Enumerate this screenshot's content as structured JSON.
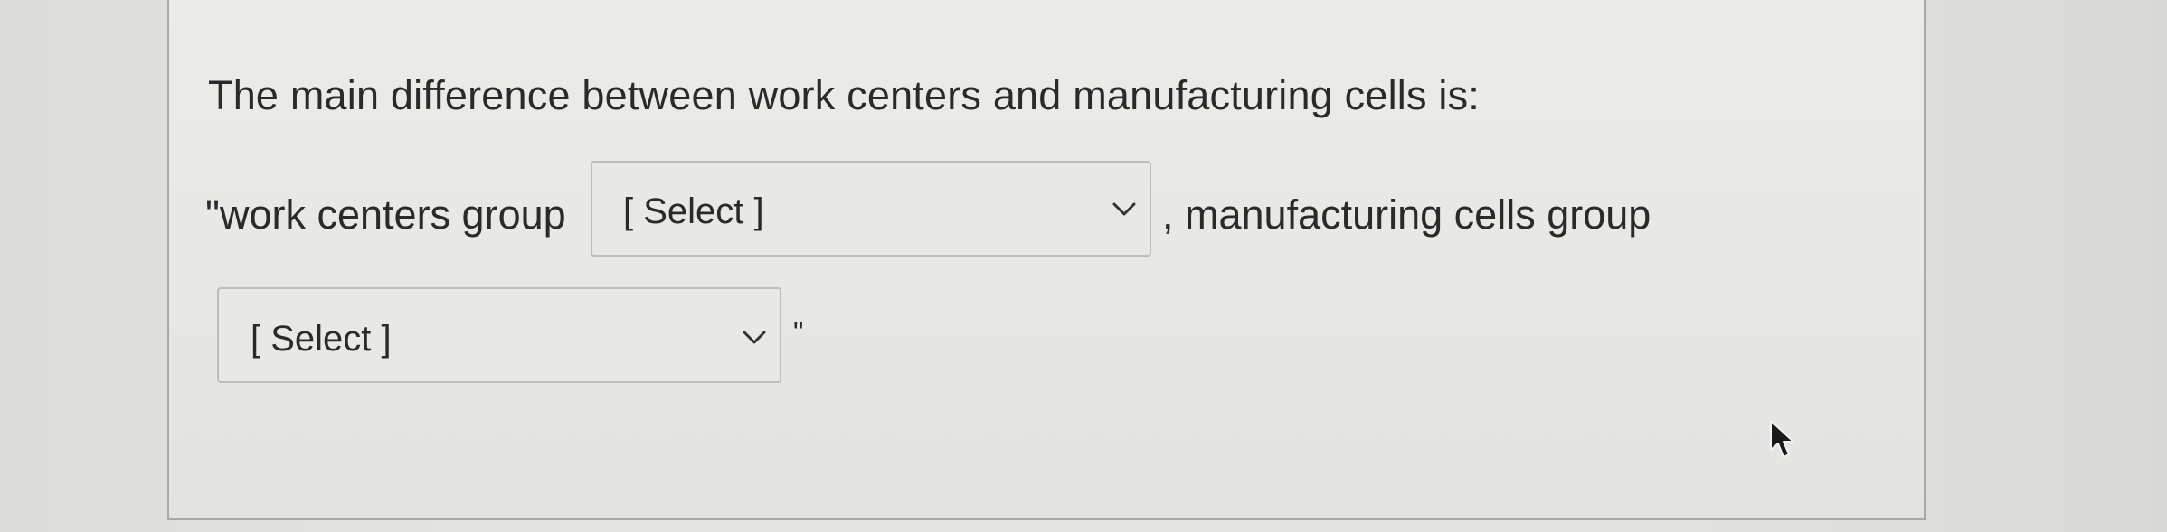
{
  "question": {
    "prompt": "The main difference between work centers and manufacturing cells is:",
    "segment_before_select_1": "\"work centers group",
    "segment_after_select_1": ", manufacturing cells group",
    "segment_after_select_2": "\""
  },
  "selects": [
    {
      "selected_label": "[ Select ]",
      "icon": "chevron-down-icon"
    },
    {
      "selected_label": "[ Select ]",
      "icon": "chevron-down-icon"
    }
  ],
  "colors": {
    "background": "#e4e4e1",
    "card_border": "#a9a9a6",
    "text": "#2a2a2a",
    "select_border": "#bdbdba"
  }
}
